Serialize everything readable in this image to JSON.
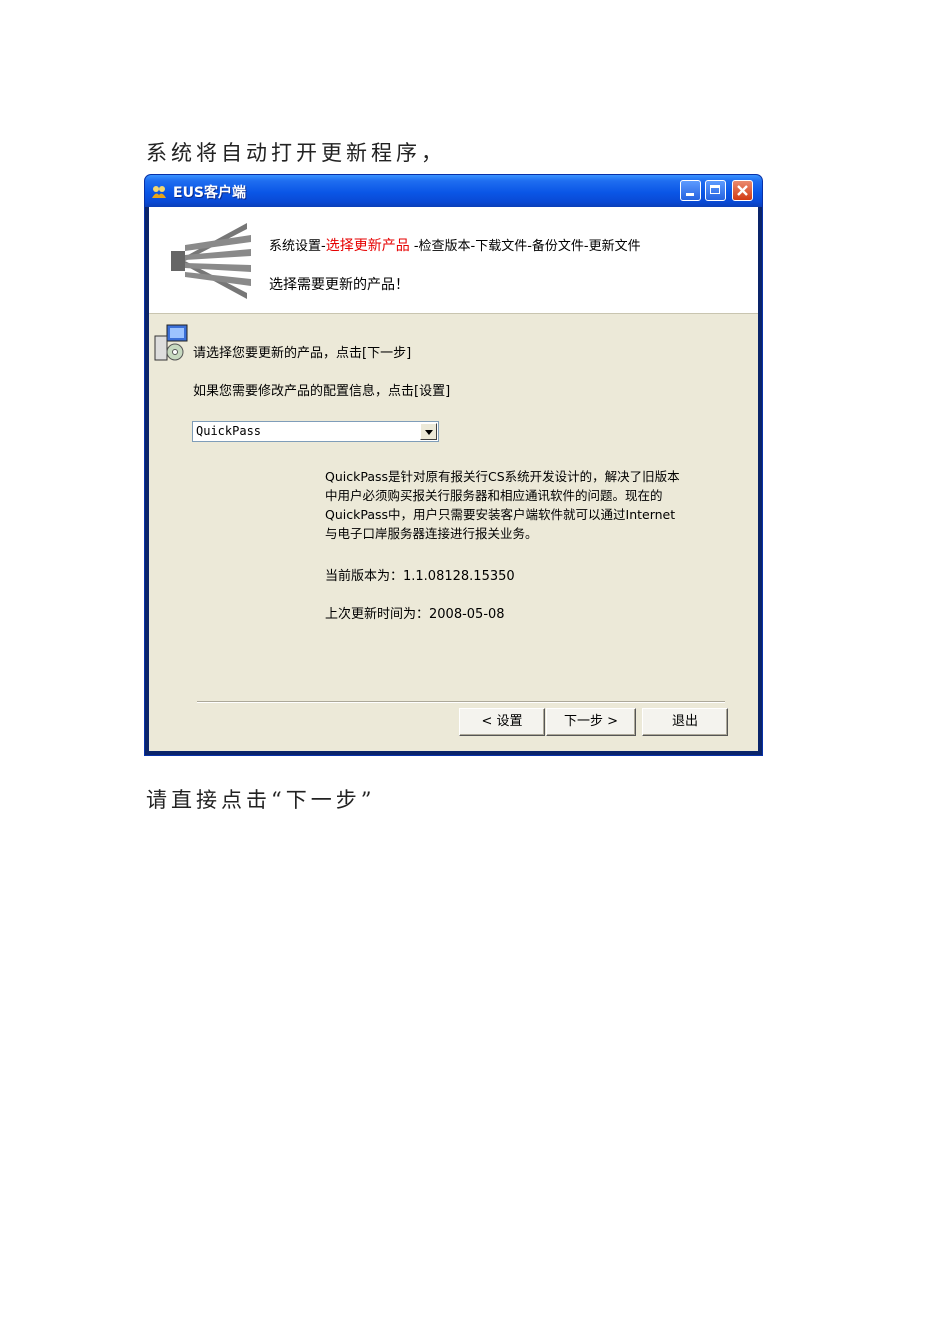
{
  "document": {
    "intro_text": "系统将自动打开更新程序，",
    "outro_text": "请直接点击“下一步”"
  },
  "window": {
    "title": "EUS客户端",
    "icons": {
      "app": "app-logo-icon",
      "header": "building-logo-icon",
      "installer": "installer-disc-icon"
    }
  },
  "header": {
    "step1": "系统设置-",
    "step_current": "选择更新产品",
    "step_rest": " -检查版本-下载文件-备份文件-更新文件",
    "subtitle": "选择需要更新的产品！"
  },
  "body": {
    "instruction1": "请选择您要更新的产品，点击[下一步]",
    "instruction2": "如果您需要修改产品的配置信息，点击[设置]",
    "product_select": "QuickPass",
    "description_lines": [
      "QuickPass是针对原有报关行CS系统开发设计的，解决了旧版本",
      "中用户必须购买报关行服务器和相应通讯软件的问题。现在的",
      "QuickPass中，用户只需要安装客户端软件就可以通过Internet",
      "与电子口岸服务器连接进行报关业务。"
    ],
    "current_version": "当前版本为：1.1.08128.15350",
    "last_update": "上次更新时间为：2008-05-08"
  },
  "buttons": {
    "settings": "< 设置",
    "next": "下一步 >",
    "exit": "退出"
  },
  "colors": {
    "title_bar": "#0a56e6",
    "client_bg": "#ece9d8",
    "current_step": "#e60000"
  }
}
